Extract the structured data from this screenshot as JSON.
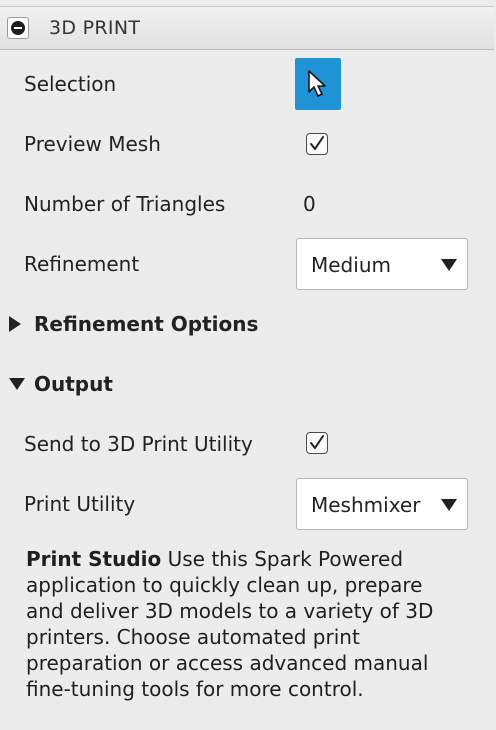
{
  "panel": {
    "title": "3D PRINT",
    "collapse_icon": "minus-circle-icon"
  },
  "rows": {
    "selection": {
      "label": "Selection",
      "icon": "arrow-cursor-icon",
      "accent": "#1e93d6"
    },
    "preview_mesh": {
      "label": "Preview Mesh",
      "checked": true
    },
    "num_triangles": {
      "label": "Number of Triangles",
      "value": "0"
    },
    "refinement": {
      "label": "Refinement",
      "selected": "Medium"
    }
  },
  "sections": {
    "refinement_options": {
      "label": "Refinement Options",
      "expanded": false
    },
    "output": {
      "label": "Output",
      "expanded": true
    }
  },
  "output": {
    "send_to_utility": {
      "label": "Send to 3D Print Utility",
      "checked": true
    },
    "print_utility": {
      "label": "Print Utility",
      "selected": "Meshmixer"
    }
  },
  "description": {
    "title": "Print Studio",
    "body": " Use this Spark Powered application to quickly clean up, prepare and deliver 3D models to a variety of 3D printers. Choose automated print preparation or access advanced manual fine-tuning tools for more control."
  }
}
